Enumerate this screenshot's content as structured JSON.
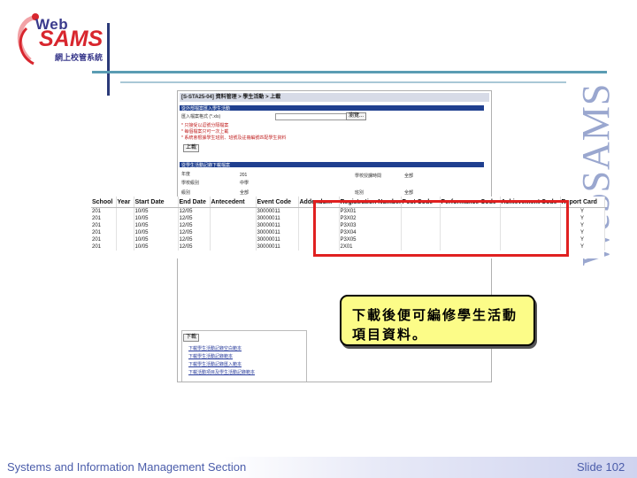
{
  "logo": {
    "web": "Web",
    "sams": "SAMS",
    "subtitle": "網上校管系統"
  },
  "watermark": "WebSAMS",
  "screenshot": {
    "title": "[S-STA25-04] 資料管理 > 學生活動 > 上載",
    "section1": "從外部檔案匯入學生活動",
    "file_label": "匯入檔案格式 (*.xls)",
    "browse_label": "瀏覽...",
    "note1": "* 只接受以逗號分隔檔案",
    "note2": "* 每個檔案只可一次上載",
    "note3": "* 系統會根據學生班別、班號及註冊編號匹配學生資料",
    "upload_button": "上載",
    "section2": "從學生活動記錄下載檔案",
    "year_label": "年度",
    "year_value": "201",
    "school_level_label": "學校級別",
    "school_level_value": "中學",
    "class_level_label": "級別",
    "class_level_value": "全部",
    "session_label": "學校授課時間",
    "session_value": "全部",
    "class_label": "班別",
    "class_value": "全部",
    "download_button": "下載",
    "links": [
      "下載學生活動記錄空白範本",
      "下載學生活動記錄範本",
      "下載學生活動記錄匯入範本",
      "下載活動項目及學生活動記錄範本"
    ]
  },
  "table": {
    "headers": [
      "School",
      "Year",
      "Start Date",
      "End Date",
      "Antecedent",
      "Event Code",
      "Addendum",
      "Registration Number",
      "Post Code",
      "Performance Code",
      "Achievement Code",
      "Report Card"
    ],
    "rows": [
      {
        "school": "201",
        "start": "10/05",
        "end": "12/05",
        "event": "30000011",
        "reg": "P3X01",
        "report": "Y"
      },
      {
        "school": "201",
        "start": "10/05",
        "end": "12/05",
        "event": "30000011",
        "reg": "P3X02",
        "report": "Y"
      },
      {
        "school": "201",
        "start": "10/05",
        "end": "12/05",
        "event": "30000011",
        "reg": "P3X03",
        "report": "Y"
      },
      {
        "school": "201",
        "start": "10/05",
        "end": "12/05",
        "event": "30000011",
        "reg": "P3X04",
        "report": "Y"
      },
      {
        "school": "201",
        "start": "10/05",
        "end": "12/05",
        "event": "30000011",
        "reg": "P3X05",
        "report": "Y"
      },
      {
        "school": "201",
        "start": "10/05",
        "end": "12/05",
        "event": "30000011",
        "reg": "2X01",
        "report": "Y"
      }
    ]
  },
  "callout": {
    "line1": "下載後便可編修學生活動",
    "line2": "項目資料。"
  },
  "footer": {
    "left": "Systems and Information Management Section",
    "right": "Slide 102"
  }
}
